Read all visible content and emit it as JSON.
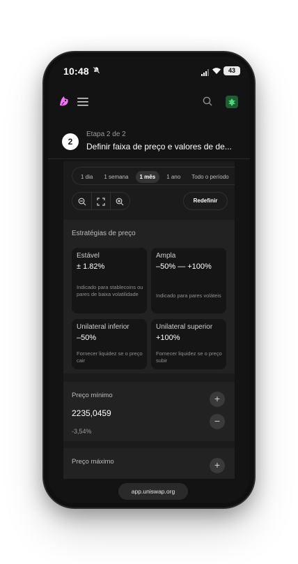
{
  "status_bar": {
    "time": "10:48",
    "battery": "43"
  },
  "nav": {
    "logo": "uniswap-logo",
    "menu_icon": "menu-icon",
    "search_icon": "search-icon",
    "wallet_icon": "wallet-avatar-icon"
  },
  "step": {
    "number": "2",
    "subtitle": "Etapa 2 de 2",
    "title": "Definir faixa de preço e valores de de..."
  },
  "time_range": {
    "options": [
      "1 dia",
      "1 semana",
      "1 mês",
      "1 ano",
      "Todo o período"
    ],
    "selected": "1 mês"
  },
  "chart_controls": {
    "zoom_out_icon": "zoom-out-icon",
    "fit_icon": "fit-screen-icon",
    "zoom_in_icon": "zoom-in-icon",
    "reset_label": "Redefinir"
  },
  "strategies": {
    "title": "Estratégias de preço",
    "cards": [
      {
        "name": "Estável",
        "value": "± 1.82%",
        "description": "Indicado para stablecoins ou pares de baixa volatilidade"
      },
      {
        "name": "Ampla",
        "value": "–50% — +100%",
        "description": "Indicado para pares voláteis"
      },
      {
        "name": "Unilateral inferior",
        "value": "–50%",
        "description": "Fornecer liquidez se o preço cair"
      },
      {
        "name": "Unilateral superior",
        "value": "+100%",
        "description": "Fornecer liquidez se o preço subir"
      }
    ]
  },
  "min_price": {
    "label": "Preço mínimo",
    "value": "2235,0459",
    "percent": "-3,54%",
    "increment": "+",
    "decrement": "−"
  },
  "max_price": {
    "label": "Preço máximo",
    "increment": "+"
  },
  "browser": {
    "url": "app.uniswap.org"
  },
  "colors": {
    "background": "#131313",
    "card": "#151515",
    "section": "#222222",
    "accent_pink": "#fc72ff",
    "wallet_green": "#1f5c33"
  }
}
